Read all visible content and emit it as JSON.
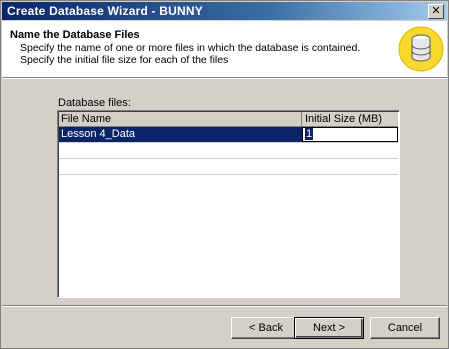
{
  "window": {
    "title": "Create Database Wizard - BUNNY",
    "close_glyph": "✕"
  },
  "header": {
    "title": "Name the Database Files",
    "description": "Specify the name of one or more files in which the database is contained. Specify the initial file size for each of the files",
    "icon": "database-icon"
  },
  "files": {
    "label": "Database files:",
    "columns": {
      "name": "File Name",
      "size": "Initial Size (MB)"
    },
    "rows": [
      {
        "name": "Lesson 4_Data",
        "size": "1"
      }
    ]
  },
  "buttons": {
    "back": "< Back",
    "next": "Next >",
    "cancel": "Cancel"
  },
  "colors": {
    "title_start": "#0a246a",
    "title_end": "#a6caf0",
    "selection": "#0a246a",
    "face": "#d4d0c8"
  }
}
